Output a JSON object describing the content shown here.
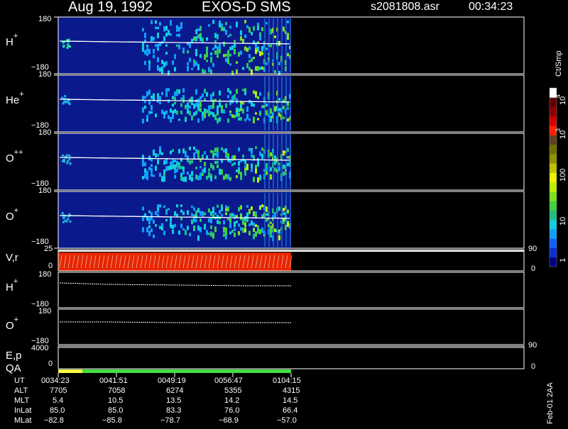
{
  "header": {
    "date": "Aug 19, 1992",
    "instrument": "EXOS-D SMS",
    "file": "s2081808.asr",
    "time": "00:34:23"
  },
  "colorbar": {
    "unit": "Ct/Smp",
    "ticks": [
      "1",
      "10",
      "100",
      "10",
      "3",
      "10",
      "4"
    ],
    "colors": [
      "#000080",
      "#0a2fd0",
      "#1060ff",
      "#10a0ff",
      "#10d0e0",
      "#20c080",
      "#40d040",
      "#80e020",
      "#c0f000",
      "#f0f000",
      "#c0c000",
      "#909000",
      "#707000",
      "#604020",
      "#ff2000",
      "#d00000",
      "#900000",
      "#600000",
      "#ffffff"
    ]
  },
  "panels": [
    {
      "name": "H",
      "sup": "+",
      "ymax": "180",
      "ymin": "−180"
    },
    {
      "name": "He",
      "sup": "+",
      "ymax": "180",
      "ymin": "−180"
    },
    {
      "name": "O",
      "sup": "++",
      "ymax": "180",
      "ymin": "−180"
    },
    {
      "name": "O",
      "sup": "+",
      "ymax": "180",
      "ymin": "−180"
    }
  ],
  "vr_panel": {
    "label": "V,r",
    "left_top": "25",
    "left_bottom": "0",
    "right_top": "90",
    "right_bottom": "0"
  },
  "h_line_panel": {
    "name": "H",
    "sup": "+",
    "ymax": "180",
    "ymin": "−180"
  },
  "o_line_panel": {
    "name": "O",
    "sup": "+",
    "ymax": "180",
    "ymin": "−180"
  },
  "ep_panel": {
    "label": "E,p",
    "left_top": "4000",
    "left_bottom": "0",
    "right_top": "90",
    "right_bottom": "0"
  },
  "qa": {
    "label": "QA"
  },
  "footer": {
    "labels": [
      "UT",
      "ALT",
      "MLT",
      "InLat",
      "MLat"
    ],
    "columns": [
      [
        "0034:23",
        "7705",
        "5.4",
        "85.0",
        "−82.8"
      ],
      [
        "0041:51",
        "7058",
        "10.5",
        "85.0",
        "−85.8"
      ],
      [
        "0049:19",
        "6274",
        "13.5",
        "83.3",
        "−78.7"
      ],
      [
        "0056:47",
        "5355",
        "14.2",
        "76.0",
        "−68.9"
      ],
      [
        "0104:15",
        "4315",
        "14.5",
        "66.4",
        "−57.0"
      ]
    ],
    "stamp": "Feb-01 2AA"
  },
  "chart_data": {
    "type": "heatmap",
    "title": "Aug 19, 1992   EXOS-D SMS",
    "x_ticks": [
      "0034:23",
      "0041:51",
      "0049:19",
      "0056:47",
      "0104:15"
    ],
    "panels": [
      {
        "species": "H+",
        "ylim": [
          -180,
          180
        ]
      },
      {
        "species": "He+",
        "ylim": [
          -180,
          180
        ]
      },
      {
        "species": "O++",
        "ylim": [
          -180,
          180
        ]
      },
      {
        "species": "O+",
        "ylim": [
          -180,
          180
        ]
      }
    ],
    "colorbar": {
      "unit": "Ct/Smp",
      "scale": "log",
      "range": [
        1,
        10000
      ]
    }
  }
}
